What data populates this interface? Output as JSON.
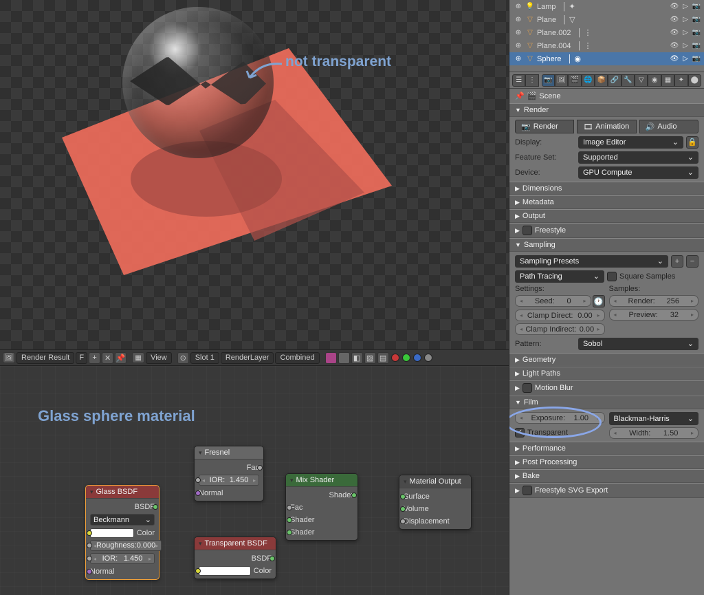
{
  "annotations": {
    "not_transparent": "not transparent",
    "glass_material": "Glass sphere material"
  },
  "image_header": {
    "result": "Render Result",
    "f": "F",
    "view": "View",
    "slot": "Slot 1",
    "layer": "RenderLayer",
    "pass": "Combined"
  },
  "nodes": {
    "glass": {
      "title": "Glass BSDF",
      "out": "BSDF",
      "method": "Beckmann",
      "color": "Color",
      "rough_l": "Roughness:",
      "rough_v": "0.000",
      "ior_l": "IOR:",
      "ior_v": "1.450",
      "normal": "Normal"
    },
    "fresnel": {
      "title": "Fresnel",
      "out": "Fac",
      "ior_l": "IOR:",
      "ior_v": "1.450",
      "normal": "Normal"
    },
    "transparent": {
      "title": "Transparent BSDF",
      "out": "BSDF",
      "color": "Color"
    },
    "mix": {
      "title": "Mix Shader",
      "out": "Shader",
      "fac": "Fac",
      "sh1": "Shader",
      "sh2": "Shader"
    },
    "output": {
      "title": "Material Output",
      "surface": "Surface",
      "volume": "Volume",
      "displacement": "Displacement"
    }
  },
  "outliner": {
    "items": [
      {
        "icon": "lamp",
        "name": "Lamp"
      },
      {
        "icon": "mesh",
        "name": "Plane"
      },
      {
        "icon": "mesh",
        "name": "Plane.002"
      },
      {
        "icon": "mesh",
        "name": "Plane.004"
      },
      {
        "icon": "mesh",
        "name": "Sphere",
        "selected": true
      }
    ]
  },
  "scene_label": "Scene",
  "panels": {
    "render": {
      "title": "Render",
      "btn_render": "Render",
      "btn_anim": "Animation",
      "btn_audio": "Audio",
      "display_l": "Display:",
      "display_v": "Image Editor",
      "feature_l": "Feature Set:",
      "feature_v": "Supported",
      "device_l": "Device:",
      "device_v": "GPU Compute"
    },
    "dimensions": "Dimensions",
    "metadata": "Metadata",
    "output": "Output",
    "freestyle": "Freestyle",
    "sampling": {
      "title": "Sampling",
      "presets": "Sampling Presets",
      "integrator": "Path Tracing",
      "square": "Square Samples",
      "settings_l": "Settings:",
      "samples_l": "Samples:",
      "seed_l": "Seed:",
      "seed_v": "0",
      "clampd_l": "Clamp Direct:",
      "clampd_v": "0.00",
      "clampi_l": "Clamp Indirect:",
      "clampi_v": "0.00",
      "render_l": "Render:",
      "render_v": "256",
      "preview_l": "Preview:",
      "preview_v": "32",
      "pattern_l": "Pattern:",
      "pattern_v": "Sobol"
    },
    "geometry": "Geometry",
    "lightpaths": "Light Paths",
    "motionblur": "Motion Blur",
    "film": {
      "title": "Film",
      "exposure_l": "Exposure:",
      "exposure_v": "1.00",
      "transparent": "Transparent",
      "filter": "Blackman-Harris",
      "width_l": "Width:",
      "width_v": "1.50"
    },
    "performance": "Performance",
    "postproc": "Post Processing",
    "bake": "Bake",
    "svg": "Freestyle SVG Export"
  }
}
